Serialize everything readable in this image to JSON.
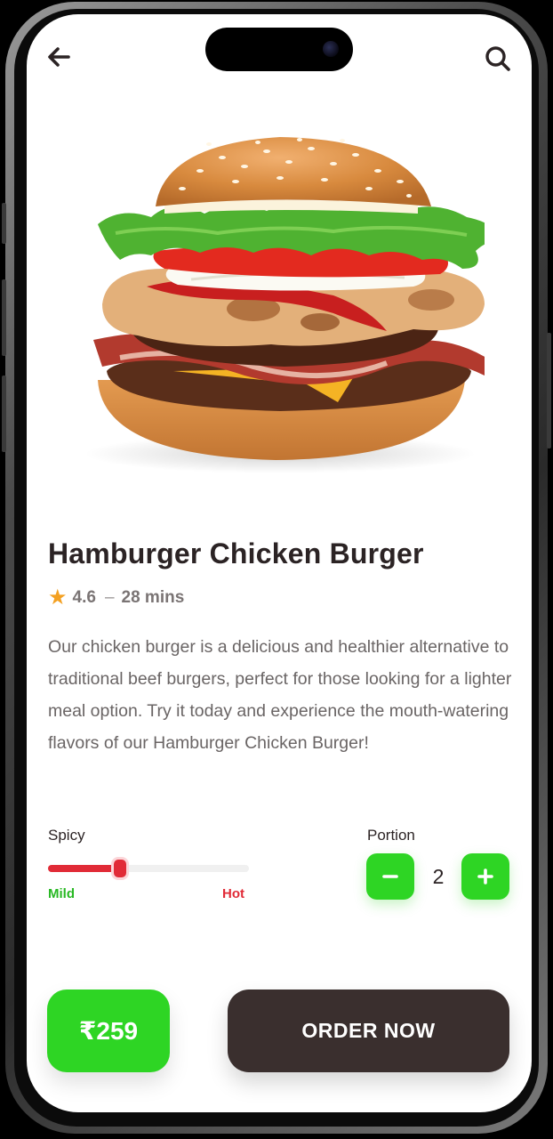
{
  "product": {
    "title": "Hamburger Chicken Burger",
    "rating": "4.6",
    "separator": "–",
    "time": "28 mins",
    "description": "Our chicken burger is a delicious and healthier alternative to traditional beef burgers, perfect for those looking for a lighter meal option. Try it today and experience the mouth-watering flavors of our Hamburger Chicken Burger!"
  },
  "spicy": {
    "label": "Spicy",
    "min_label": "Mild",
    "max_label": "Hot",
    "level": 0.36
  },
  "portion": {
    "label": "Portion",
    "quantity": "2",
    "minus": "−",
    "plus": "+"
  },
  "footer": {
    "price": "₹259",
    "order_label": "ORDER NOW"
  },
  "icons": {
    "back": "arrow-left-icon",
    "search": "search-icon",
    "rating": "star-icon"
  },
  "colors": {
    "accent_green": "#2ed524",
    "dark_button": "#3a2f2e",
    "hot_red": "#e12b37",
    "star": "#f3a021"
  }
}
